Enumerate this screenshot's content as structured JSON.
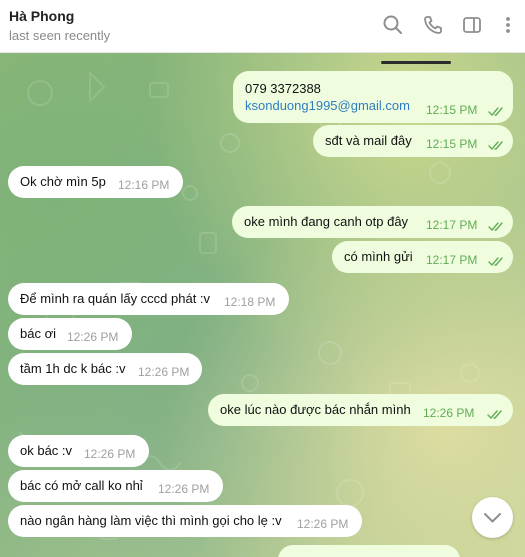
{
  "header": {
    "contact_name": "Hà Phong",
    "status": "last seen recently",
    "icons": [
      "search-icon",
      "phone-icon",
      "sidebar-icon",
      "more-vertical-icon"
    ]
  },
  "colors": {
    "incoming_bubble": "#ffffff",
    "outgoing_bubble": "#effdde",
    "outgoing_time": "#62ac55",
    "link": "#2e7ebf"
  },
  "messages": [
    {
      "dir": "out",
      "lines": [
        "079 3372388",
        "ksonduong1995@gmail.com"
      ],
      "time": "12:15 PM",
      "read": true
    },
    {
      "dir": "out",
      "text": "sđt và mail đây",
      "time": "12:15 PM",
      "read": true
    },
    {
      "dir": "in",
      "text": "Ok chờ mìn 5p",
      "time": "12:16 PM"
    },
    {
      "dir": "out",
      "text": "oke mình đang canh otp đây",
      "time": "12:17 PM",
      "read": true
    },
    {
      "dir": "out",
      "text": "có mình gửi",
      "time": "12:17 PM",
      "read": true
    },
    {
      "dir": "in",
      "text": "Để mình ra quán lấy cccd phát :v",
      "time": "12:18 PM"
    },
    {
      "dir": "in",
      "text": "bác ơi",
      "time": "12:26 PM"
    },
    {
      "dir": "in",
      "text": "tầm 1h dc k bác :v",
      "time": "12:26 PM"
    },
    {
      "dir": "out",
      "text": "oke lúc nào được bác nhắn mình",
      "time": "12:26 PM",
      "read": true
    },
    {
      "dir": "in",
      "text": "ok bác :v",
      "time": "12:26 PM"
    },
    {
      "dir": "in",
      "text": "bác có mở call ko  nhỉ",
      "time": "12:26 PM"
    },
    {
      "dir": "in",
      "text": "nào ngân hàng làm việc thì mình gọi cho lẹ :v",
      "time": "12:26 PM"
    }
  ],
  "scroll_button_icon": "chevron-down-icon"
}
